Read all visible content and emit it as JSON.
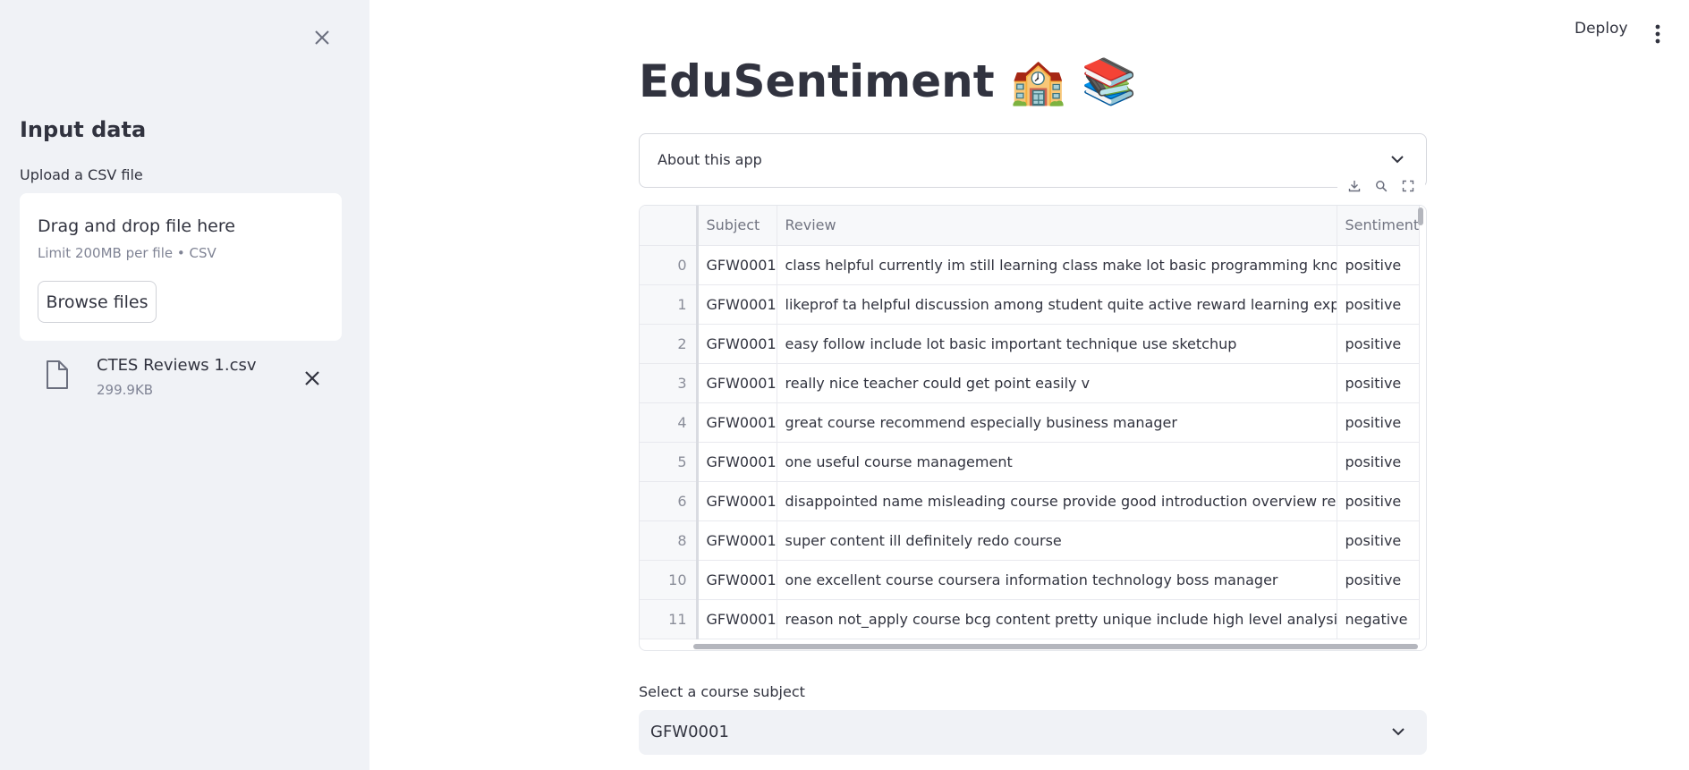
{
  "sidebar": {
    "title": "Input data",
    "upload_label": "Upload a CSV file",
    "dropzone_title": "Drag and drop file here",
    "dropzone_limit": "Limit 200MB per file • CSV",
    "browse_label": "Browse files",
    "file": {
      "name": "CTES Reviews 1.csv",
      "size": "299.9KB"
    }
  },
  "header": {
    "deploy_label": "Deploy"
  },
  "main": {
    "title": "EduSentiment 🏫 📚",
    "expander_label": "About this app",
    "table": {
      "columns": [
        "",
        "Subject",
        "Review",
        "Sentiment"
      ],
      "rows": [
        {
          "index": "0",
          "subject": "GFW0001",
          "review": "class helpful currently im still learning class make lot basic programming knowledge",
          "sentiment": "positive"
        },
        {
          "index": "1",
          "subject": "GFW0001",
          "review": "likeprof ta helpful discussion among student quite active reward learning experience",
          "sentiment": "positive"
        },
        {
          "index": "2",
          "subject": "GFW0001",
          "review": "easy follow include lot basic important technique use sketchup",
          "sentiment": "positive"
        },
        {
          "index": "3",
          "subject": "GFW0001",
          "review": "really nice teacher could get point easily v",
          "sentiment": "positive"
        },
        {
          "index": "4",
          "subject": "GFW0001",
          "review": "great course recommend especially business manager",
          "sentiment": "positive"
        },
        {
          "index": "5",
          "subject": "GFW0001",
          "review": "one useful course management",
          "sentiment": "positive"
        },
        {
          "index": "6",
          "subject": "GFW0001",
          "review": "disappointed name misleading course provide good introduction overview responsibi",
          "sentiment": "positive"
        },
        {
          "index": "8",
          "subject": "GFW0001",
          "review": "super content ill definitely redo course",
          "sentiment": "positive"
        },
        {
          "index": "10",
          "subject": "GFW0001",
          "review": "one excellent course coursera information technology boss manager",
          "sentiment": "positive"
        },
        {
          "index": "11",
          "subject": "GFW0001",
          "review": "reason not_apply course bcg content pretty unique include high level analysis wide r",
          "sentiment": "negative"
        }
      ]
    },
    "select": {
      "label": "Select a course subject",
      "value": "GFW0001"
    }
  }
}
